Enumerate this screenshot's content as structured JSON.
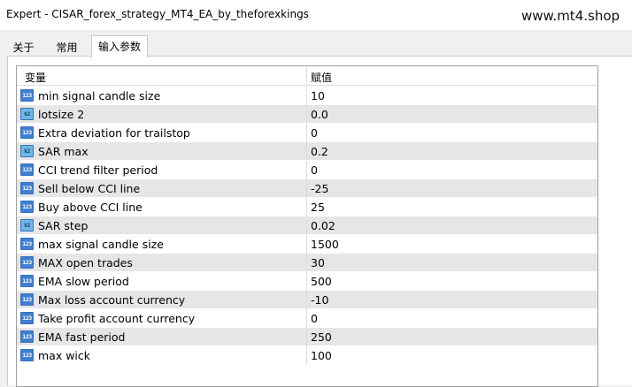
{
  "window": {
    "title": "Expert - CISAR_forex_strategy_MT4_EA_by_theforexkings",
    "watermark": "www.mt4.shop"
  },
  "tabs": [
    {
      "label": "关于"
    },
    {
      "label": "常用"
    },
    {
      "label": "输入参数",
      "active": true
    }
  ],
  "grid": {
    "header_variable": "变量",
    "header_value": "赋值",
    "rows": [
      {
        "type": "int",
        "icon": "123",
        "name": "min signal candle size",
        "value": "10"
      },
      {
        "type": "double",
        "icon": "V2",
        "name": "lotsize 2",
        "value": "0.0"
      },
      {
        "type": "int",
        "icon": "123",
        "name": "Extra deviation for trailstop",
        "value": "0"
      },
      {
        "type": "double",
        "icon": "V2",
        "name": "SAR max",
        "value": "0.2"
      },
      {
        "type": "int",
        "icon": "123",
        "name": "CCI trend filter period",
        "value": "0"
      },
      {
        "type": "int",
        "icon": "123",
        "name": "Sell below CCI line",
        "value": "-25"
      },
      {
        "type": "int",
        "icon": "123",
        "name": "Buy above CCI line",
        "value": "25"
      },
      {
        "type": "double",
        "icon": "V2",
        "name": "SAR step",
        "value": "0.02"
      },
      {
        "type": "int",
        "icon": "123",
        "name": "max signal candle size",
        "value": "1500"
      },
      {
        "type": "int",
        "icon": "123",
        "name": "MAX open trades",
        "value": "30"
      },
      {
        "type": "int",
        "icon": "123",
        "name": "EMA slow period",
        "value": "500"
      },
      {
        "type": "int",
        "icon": "123",
        "name": "Max loss account currency",
        "value": "-10"
      },
      {
        "type": "int",
        "icon": "123",
        "name": "Take profit account currency",
        "value": "0"
      },
      {
        "type": "int",
        "icon": "123",
        "name": "EMA fast period",
        "value": "250"
      },
      {
        "type": "int",
        "icon": "123",
        "name": "max wick",
        "value": "100"
      }
    ]
  },
  "colors": {
    "row_alt": "#e6e6e6",
    "int_icon": "#3f7fcf",
    "double_icon": "#6fb8e6"
  }
}
